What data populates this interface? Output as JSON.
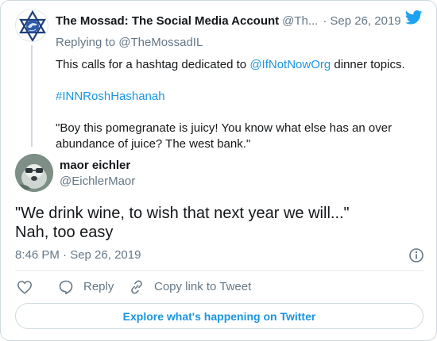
{
  "parent_tweet": {
    "author_name": "The Mossad: The Social Media Account",
    "author_handle": "@Th...",
    "date": "Sep 26, 2019",
    "replying_to": "Replying to @TheMossadIL",
    "body": {
      "line1_prefix": "This calls for a hashtag dedicated to ",
      "line1_mention": "@IfNotNowOrg",
      "line1_suffix": " dinner topics.",
      "hashtag": "#INNRoshHashanah",
      "quote_line1": "\"Boy this pomegranate is juicy! You know what else has an over",
      "quote_line2": "abundance of juice? The west bank.\""
    }
  },
  "main_tweet": {
    "author_name": "maor eichler",
    "author_handle": "@EichlerMaor",
    "text_line1": "\"We drink wine, to wish that next year we will...\"",
    "text_line2": "Nah, too easy",
    "timestamp": "8:46 PM · Sep 26, 2019"
  },
  "actions": {
    "like_icon": "heart-icon",
    "reply_label": "Reply",
    "copy_link_label": "Copy link to Tweet"
  },
  "footer": {
    "explore_label": "Explore what's happening on Twitter"
  },
  "colors": {
    "link": "#1b95e0",
    "muted": "#657786",
    "border": "#cfd9de",
    "twitter_blue": "#1da1f2"
  }
}
